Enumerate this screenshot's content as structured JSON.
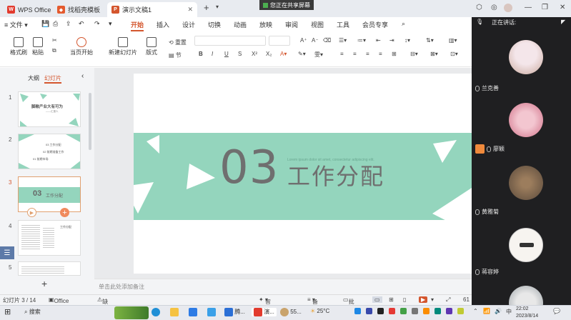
{
  "titlebar": {
    "tabs": [
      {
        "label": "WPS Office"
      },
      {
        "label": "找稻壳模板"
      },
      {
        "label": "演示文稿1"
      }
    ],
    "new_tab": "+",
    "sharing_banner": "您正在共享屏幕"
  },
  "menu": {
    "file": "文件",
    "items": [
      "开始",
      "插入",
      "设计",
      "切换",
      "动画",
      "放映",
      "审阅",
      "视图",
      "工具",
      "会员专享"
    ]
  },
  "toolbar": {
    "format_painter": "格式刷",
    "paste": "粘贴",
    "from_current": "当页开始",
    "new_slide": "新建幻灯片",
    "layout": "版式",
    "reset": "重置",
    "section": "节"
  },
  "sidebar": {
    "tab_outline": "大纲",
    "tab_slides": "幻灯片",
    "slides": [
      {
        "num": "1",
        "title": "脚敞产业大有可为",
        "subtitle": "——汇报人"
      },
      {
        "num": "2",
        "items": [
          "03 工作分配",
          "02 前期准备工作",
          "01 前期市场"
        ]
      },
      {
        "num": "3",
        "label": "工作分配",
        "number": "03"
      },
      {
        "num": "4",
        "label": "工作分配"
      },
      {
        "num": "5"
      }
    ],
    "add": "+"
  },
  "slide": {
    "number": "03",
    "small_text": "Lorem ipsum dolor sit amet, consectetur adipiscing elit.",
    "title": "工作分配"
  },
  "notes": {
    "placeholder": "单击此处添加备注"
  },
  "status": {
    "position": "幻灯片 3 / 14",
    "theme": "Office 主题",
    "missing_font": "缺失字体",
    "beautify": "智能美化",
    "notes": "备注",
    "comments": "批注",
    "zoom": "61"
  },
  "meeting": {
    "header": "正在讲话:",
    "participants": [
      {
        "name": "兰克善",
        "colors": [
          "#f4e6ea",
          "#c9a89c"
        ]
      },
      {
        "name": "廖颖",
        "colors": [
          "#f3c6d0",
          "#cf6e86"
        ]
      },
      {
        "name": "黄雅菊",
        "colors": [
          "#5a4a3c",
          "#9c7d5d"
        ]
      },
      {
        "name": "蒋容婷",
        "colors": [
          "#f7f4f0",
          "#333333"
        ]
      },
      {
        "name": "",
        "colors": [
          "#e8e8e8",
          "#9aa1a6"
        ]
      }
    ]
  },
  "taskbar": {
    "search": "搜索",
    "weather": "25°C",
    "time": "22:02",
    "date": "2023/8/14",
    "ime": "中",
    "wps": "演...",
    "app1": "腾...",
    "app2": "55..."
  },
  "colors": {
    "accent": "#d4562e",
    "mint": "#94d5bd",
    "meeting_bg": "#1f1f21"
  }
}
